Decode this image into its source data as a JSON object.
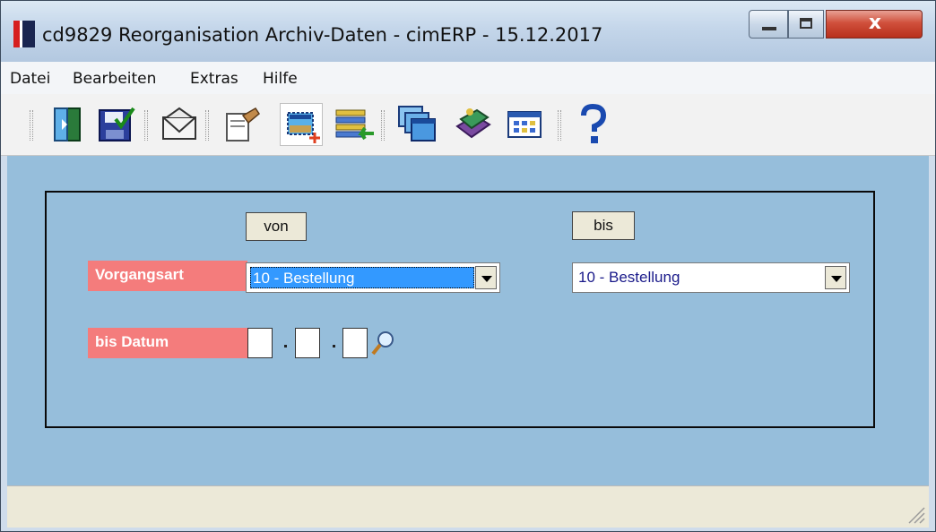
{
  "window": {
    "title": "cd9829 Reorganisation Archiv-Daten - cimERP - 15.12.2017",
    "close_glyph": "x"
  },
  "menu": [
    "Datei",
    "Bearbeiten",
    "Extras",
    "Hilfe"
  ],
  "toolbar": {
    "icons": [
      "exit-door-icon",
      "save-icon",
      "mail-icon",
      "edit-hand-icon",
      "new-record-icon",
      "list-transfer-icon",
      "windows-icon",
      "books-icon",
      "grid-icon",
      "help-icon"
    ]
  },
  "form": {
    "header_from": "von",
    "header_to": "bis",
    "vorgangsart_label": "Vorgangsart",
    "vorgangsart_from": "10 - Bestellung",
    "vorgangsart_to": "10 - Bestellung",
    "bis_datum_label": "bis Datum",
    "date_day": "",
    "date_month": "",
    "date_year": ""
  },
  "colors": {
    "client_bg": "#96bedb",
    "label_red": "#f47c7c",
    "selection": "#3399ff"
  }
}
